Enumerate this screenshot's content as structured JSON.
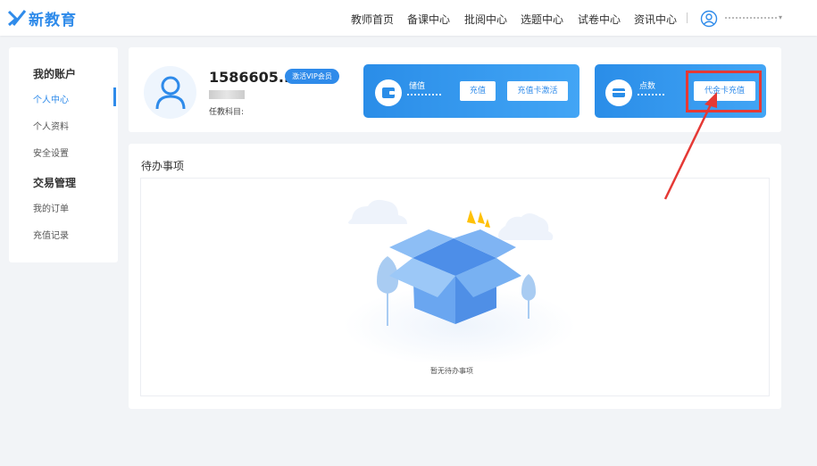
{
  "brand": {
    "name": "新教育"
  },
  "nav": {
    "items": [
      "教师首页",
      "备课中心",
      "批阅中心",
      "选题中心",
      "试卷中心",
      "资讯中心"
    ]
  },
  "sidebar": {
    "account_header": "我的账户",
    "account_items": [
      "个人中心",
      "个人资料",
      "安全设置"
    ],
    "trade_header": "交易管理",
    "trade_items": [
      "我的订单",
      "充值记录"
    ]
  },
  "profile": {
    "phone": "1586605...",
    "vip_badge": "激活VIP会员",
    "subject_label": "任教科目:"
  },
  "wallet": {
    "stored_value_label": "储值",
    "recharge_button": "充值",
    "card_activate_button": "充值卡激活",
    "points_label": "点数",
    "voucher_button": "代金卡充值"
  },
  "todo": {
    "title": "待办事项",
    "empty_text": "暂无待办事项"
  },
  "colors": {
    "accent": "#2f8bea",
    "highlight": "#e53935"
  }
}
